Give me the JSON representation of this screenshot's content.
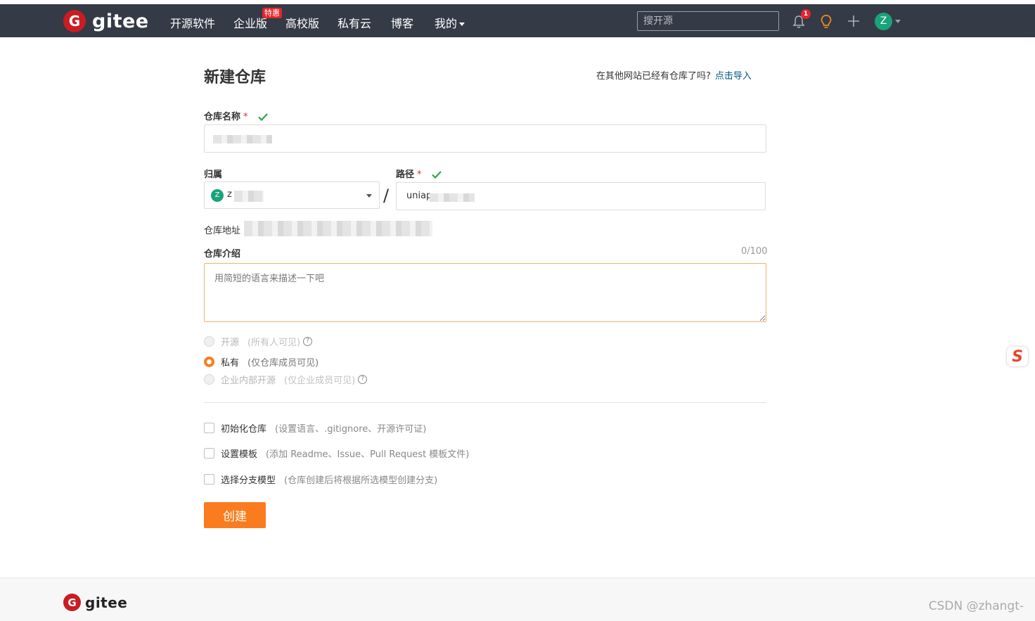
{
  "nav": {
    "logo_text": "gitee",
    "items": [
      {
        "label": "开源软件"
      },
      {
        "label": "企业版"
      },
      {
        "label": "高校版"
      },
      {
        "label": "私有云"
      },
      {
        "label": "博客"
      },
      {
        "label": "我的"
      }
    ],
    "badge": "特惠",
    "search_placeholder": "搜开源",
    "notification_count": "1",
    "avatar_letter": "Z"
  },
  "page": {
    "title": "新建仓库",
    "import_hint": "在其他网站已经有仓库了吗?",
    "import_link": "点击导入"
  },
  "form": {
    "repo_name_label": "仓库名称",
    "required_mark": "*",
    "owner_label": "归属",
    "owner_avatar": "Z",
    "owner_value": "z",
    "path_label": "路径",
    "path_value": "uniap",
    "address_label": "仓库地址",
    "desc_label": "仓库介绍",
    "desc_counter": "0/100",
    "desc_placeholder": "用简短的语言来描述一下吧",
    "visibility": [
      {
        "label": "开源",
        "note": "(所有人可见)",
        "state": "disabled"
      },
      {
        "label": "私有",
        "note": "(仅仓库成员可见)",
        "state": "selected"
      },
      {
        "label": "企业内部开源",
        "note": "(仅企业成员可见)",
        "state": "disabled"
      }
    ],
    "options": [
      {
        "label": "初始化仓库",
        "note": "(设置语言、.gitignore、开源许可证)"
      },
      {
        "label": "设置模板",
        "note": "(添加 Readme、Issue、Pull Request 模板文件)"
      },
      {
        "label": "选择分支模型",
        "note": "(仓库创建后将根据所选模型创建分支)"
      }
    ],
    "submit_label": "创建"
  },
  "footer": {
    "logo_text": "gitee",
    "watermark": "CSDN @zhangt-"
  },
  "colors": {
    "nav_bg": "#343a46",
    "accent": "#fa7c1e",
    "brand_red": "#c71d23",
    "link": "#005980",
    "success": "#2ea44f"
  }
}
